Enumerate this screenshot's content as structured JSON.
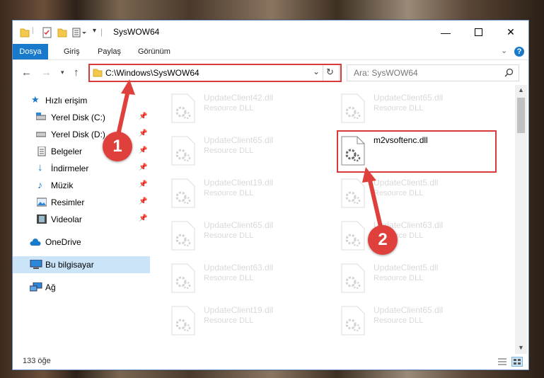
{
  "window": {
    "title": "SysWOW64",
    "minimize_icon": "minimize-icon",
    "maximize_icon": "maximize-icon",
    "close_icon": "close-icon"
  },
  "ribbon": {
    "tabs": [
      {
        "label": "Dosya"
      },
      {
        "label": "Giriş"
      },
      {
        "label": "Paylaş"
      },
      {
        "label": "Görünüm"
      }
    ],
    "help_label": "?"
  },
  "address": {
    "path": "C:\\Windows\\SysWOW64",
    "search_placeholder": "Ara: SysWOW64"
  },
  "sidebar": {
    "items": [
      {
        "label": "Hızlı erişim",
        "icon": "star-icon"
      },
      {
        "label": "Yerel Disk (C:)",
        "icon": "drive-icon"
      },
      {
        "label": "Yerel Disk (D:)",
        "icon": "drive-icon"
      },
      {
        "label": "Belgeler",
        "icon": "document-icon"
      },
      {
        "label": "İndirmeler",
        "icon": "download-arrow-icon"
      },
      {
        "label": "Müzik",
        "icon": "music-note-icon"
      },
      {
        "label": "Resimler",
        "icon": "picture-icon"
      },
      {
        "label": "Videolar",
        "icon": "film-icon"
      },
      {
        "label": "OneDrive",
        "icon": "cloud-icon"
      },
      {
        "label": "Bu bilgisayar",
        "icon": "computer-icon"
      },
      {
        "label": "Ağ",
        "icon": "network-icon"
      }
    ]
  },
  "files": [
    {
      "name": "UpdateClient42.dll",
      "type": "Resource DLL"
    },
    {
      "name": "UpdateClient65.dll",
      "type": "Resource DLL"
    },
    {
      "name": "UpdateClient65.dll",
      "type": "Resource DLL"
    },
    {
      "name": "m2vsoftenc.dll",
      "type": ""
    },
    {
      "name": "UpdateClient19.dll",
      "type": "Resource DLL"
    },
    {
      "name": "UpdateClient5.dll",
      "type": "Resource DLL"
    },
    {
      "name": "UpdateClient65.dll",
      "type": "Resource DLL"
    },
    {
      "name": "UpdateClient63.dll",
      "type": "Resource DLL"
    },
    {
      "name": "UpdateClient63.dll",
      "type": "Resource DLL"
    },
    {
      "name": "UpdateClient5.dll",
      "type": "Resource DLL"
    },
    {
      "name": "UpdateClient19.dll",
      "type": "Resource DLL"
    },
    {
      "name": "UpdateClient65.dll",
      "type": "Resource DLL"
    }
  ],
  "status": {
    "count": "133 öğe"
  },
  "annotations": {
    "step1": "1",
    "step2": "2",
    "highlight_color": "#d93a3a"
  }
}
